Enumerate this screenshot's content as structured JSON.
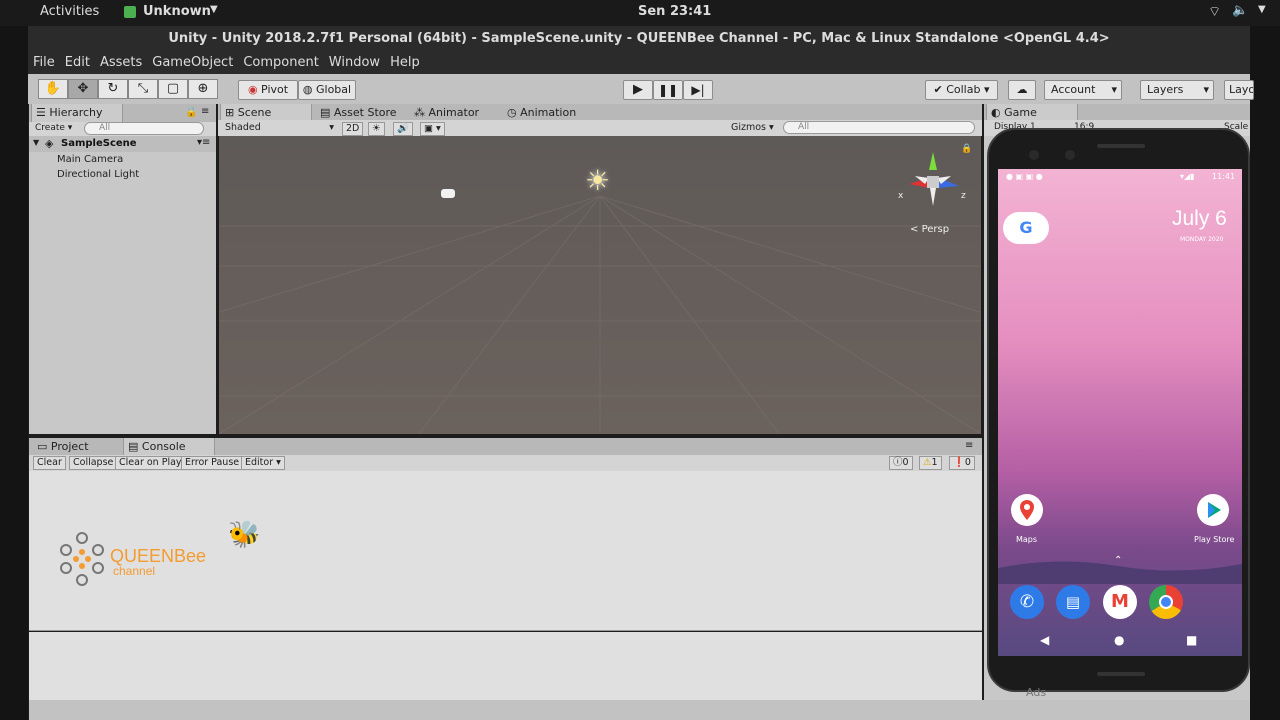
{
  "topbar": {
    "activities": "Activities",
    "app_name": "Unknown",
    "clock": "Sen 23:41"
  },
  "window_title": "Unity - Unity 2018.2.7f1 Personal (64bit) - SampleScene.unity - QUEENBee Channel - PC, Mac & Linux Standalone <OpenGL 4.4>",
  "menu": [
    "File",
    "Edit",
    "Assets",
    "GameObject",
    "Component",
    "Window",
    "Help"
  ],
  "toolbar": {
    "pivot": "Pivot",
    "global": "Global",
    "collab": "Collab",
    "account": "Account",
    "layers": "Layers",
    "layout": "Layo"
  },
  "hierarchy": {
    "tab": "Hierarchy",
    "create": "Create",
    "search_placeholder": "All",
    "scene": "SampleScene",
    "items": [
      "Main Camera",
      "Directional Light"
    ]
  },
  "scene_tabs": {
    "scene": "Scene",
    "asset_store": "Asset Store",
    "animator": "Animator",
    "animation": "Animation"
  },
  "scene_bar": {
    "shaded": "Shaded",
    "twod": "2D",
    "gizmos": "Gizmos",
    "search_placeholder": "All",
    "persp": "Persp",
    "axis_x": "x",
    "axis_z": "z"
  },
  "game": {
    "tab": "Game",
    "display": "Display 1",
    "ratio": "16:9",
    "scale": "Scale"
  },
  "bottom_tabs": {
    "project": "Project",
    "console": "Console"
  },
  "console_bar": {
    "clear": "Clear",
    "collapse": "Collapse",
    "clear_on_play": "Clear on Play",
    "error_pause": "Error Pause",
    "editor": "Editor",
    "info_count": "0",
    "warn_count": "1",
    "error_count": "0"
  },
  "logo": {
    "queen": "QUEENBee",
    "channel": "channel"
  },
  "phone": {
    "status_time": "11:41",
    "date": "July 6",
    "date_sub": "MONDAY 2020",
    "google": "G",
    "maps_label": "Maps",
    "playstore_label": "Play Store",
    "ads": "Ads"
  }
}
